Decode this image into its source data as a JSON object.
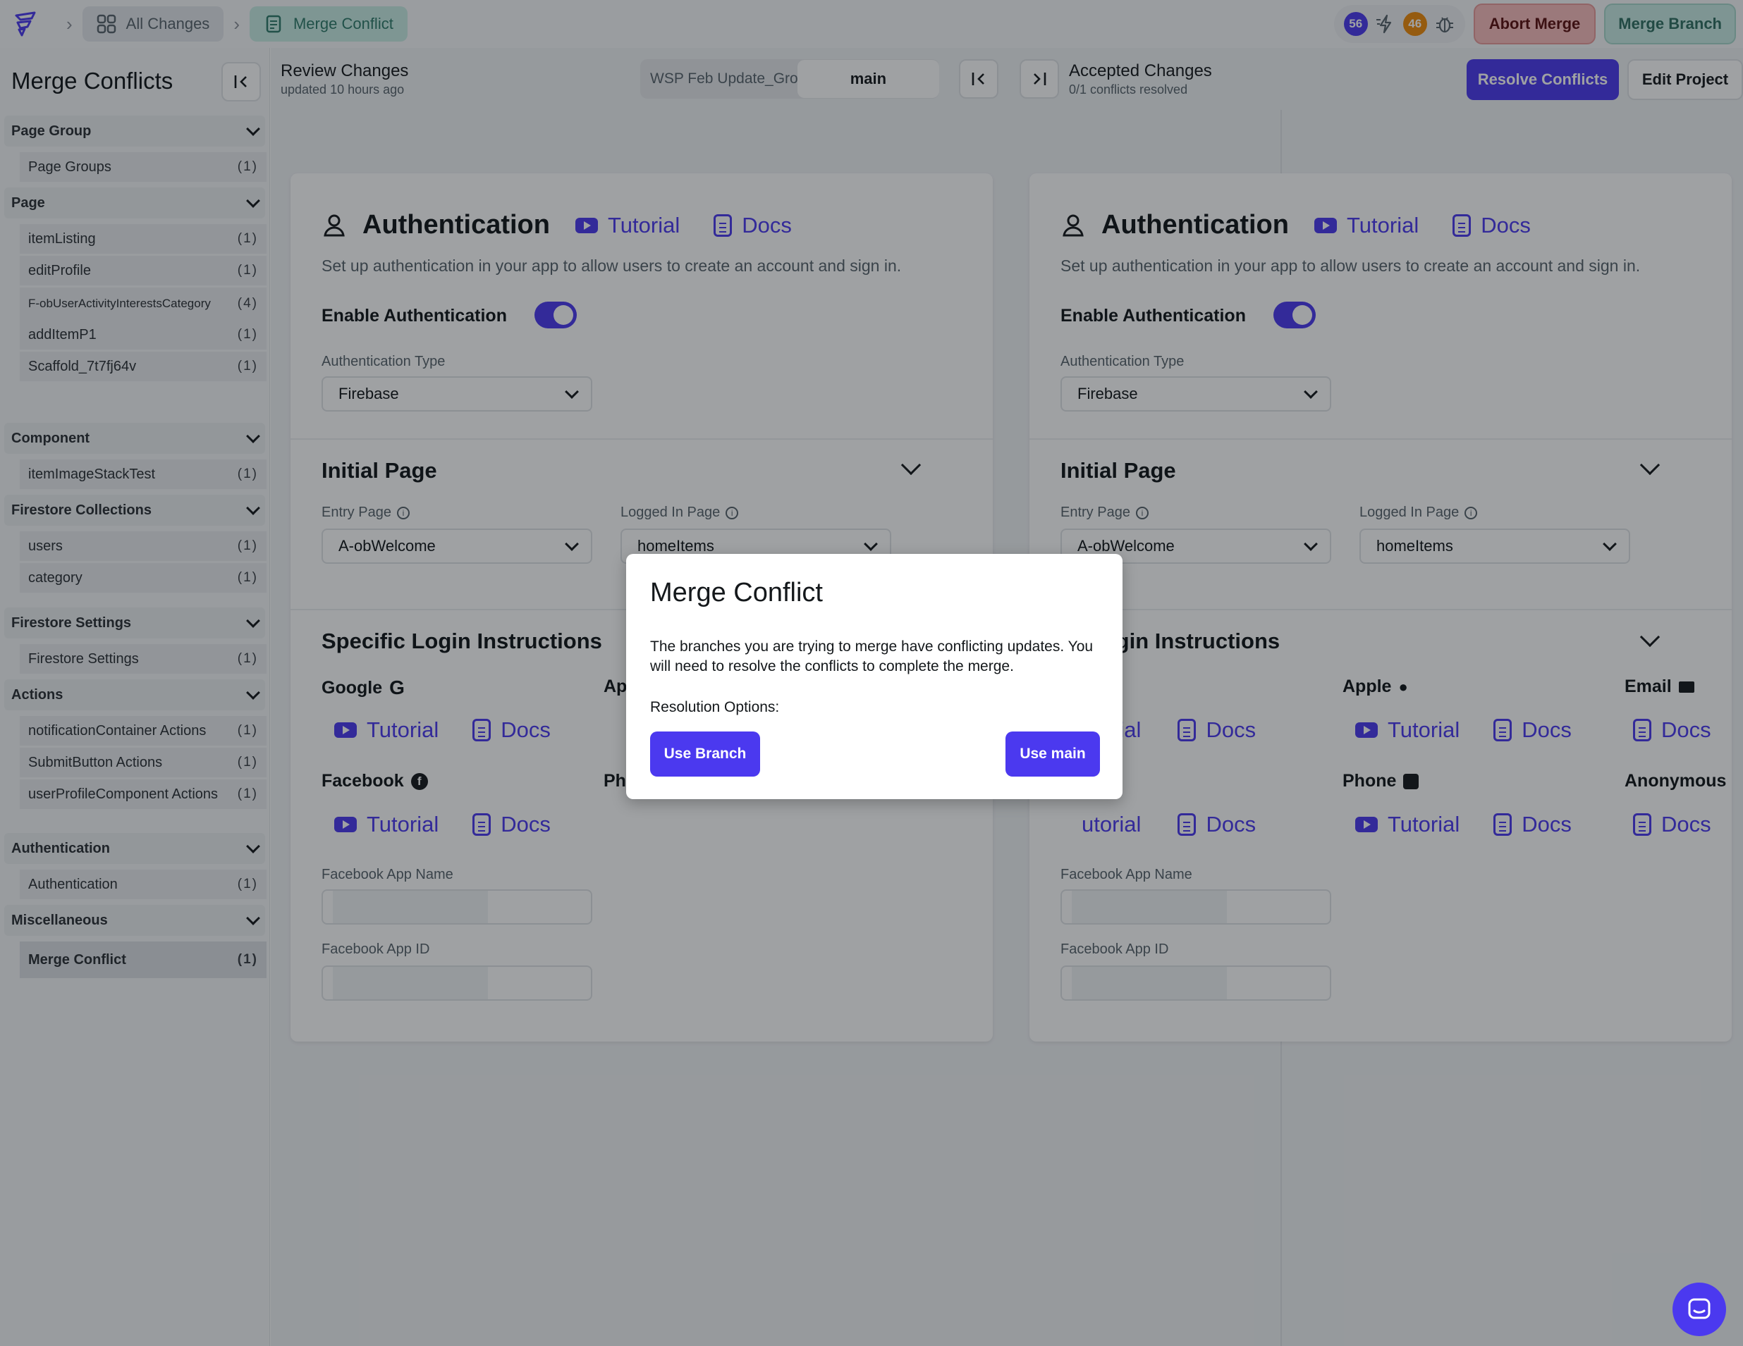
{
  "topbar": {
    "all_changes": "All Changes",
    "merge_conflict": "Merge Conflict",
    "badge_blue": "56",
    "badge_orange": "46",
    "abort_label": "Abort Merge",
    "merge_branch_label": "Merge Branch"
  },
  "sidebar": {
    "title": "Merge Conflicts",
    "sections": {
      "page_group": {
        "title": "Page Group",
        "items": [
          {
            "label": "Page Groups",
            "count": "(1)"
          }
        ]
      },
      "page": {
        "title": "Page",
        "items": [
          {
            "label": "itemListing",
            "count": "(1)"
          },
          {
            "label": "editProfile",
            "count": "(1)"
          },
          {
            "label": "F-obUserActivityInterestsCategory",
            "count": "(4)"
          },
          {
            "label": "addItemP1",
            "count": "(1)"
          },
          {
            "label": "Scaffold_7t7fj64v",
            "count": "(1)"
          }
        ]
      },
      "component": {
        "title": "Component",
        "items": [
          {
            "label": "itemImageStackTest",
            "count": "(1)"
          }
        ]
      },
      "firestore_collections": {
        "title": "Firestore Collections",
        "items": [
          {
            "label": "users",
            "count": "(1)"
          },
          {
            "label": "category",
            "count": "(1)"
          }
        ]
      },
      "firestore_settings": {
        "title": "Firestore Settings",
        "items": [
          {
            "label": "Firestore Settings",
            "count": "(1)"
          }
        ]
      },
      "actions": {
        "title": "Actions",
        "items": [
          {
            "label": "notificationContainer Actions",
            "count": "(1)"
          },
          {
            "label": "SubmitButton Actions",
            "count": "(1)"
          },
          {
            "label": "userProfileComponent Actions",
            "count": "(1)"
          }
        ]
      },
      "authentication": {
        "title": "Authentication",
        "items": [
          {
            "label": "Authentication",
            "count": "(1)"
          }
        ]
      },
      "miscellaneous": {
        "title": "Miscellaneous",
        "items": [
          {
            "label": "Merge Conflict",
            "count": "(1)"
          }
        ]
      }
    }
  },
  "review": {
    "title": "Review Changes",
    "subtitle": "updated 10 hours ago",
    "branch_name": "WSP Feb Update_Grou",
    "main_tab": "main"
  },
  "accepted": {
    "title": "Accepted Changes",
    "subtitle": "0/1 conflicts resolved",
    "resolve_label": "Resolve Conflicts",
    "edit_label": "Edit Project"
  },
  "panel": {
    "auth_title": "Authentication",
    "tutorial": "Tutorial",
    "docs": "Docs",
    "description": "Set up authentication in your app to allow users to create an account and sign in.",
    "enable_label": "Enable Authentication",
    "auth_type_label": "Authentication Type",
    "auth_type_value": "Firebase",
    "initial_page_title": "Initial Page",
    "entry_page_label": "Entry Page",
    "entry_page_value": "A-obWelcome",
    "logged_in_label": "Logged In Page",
    "logged_in_value": "homeItems",
    "specific_title": "Specific Login Instructions",
    "specific_title_partial": "fic Login Instructions",
    "google": "Google",
    "apple": "Apple",
    "apple_partial": "Ap",
    "email": "Email",
    "facebook": "Facebook",
    "facebook_partial": "ok",
    "phone": "Phone",
    "phone_partial": "Ph",
    "anonymous": "Anonymous",
    "tutorial_partial": "utorial",
    "fb_app_name_label": "Facebook App Name",
    "fb_app_id_label": "Facebook App ID"
  },
  "modal": {
    "title": "Merge Conflict",
    "body": "The branches you are trying to merge have conflicting updates. You will need to resolve the conflicts to complete the merge.",
    "options_label": "Resolution Options:",
    "use_branch": "Use Branch",
    "use_main": "Use main"
  },
  "colors": {
    "accent": "#4b39ef",
    "abort": "#f8bcbc",
    "merge_branch": "#c8ece4"
  }
}
